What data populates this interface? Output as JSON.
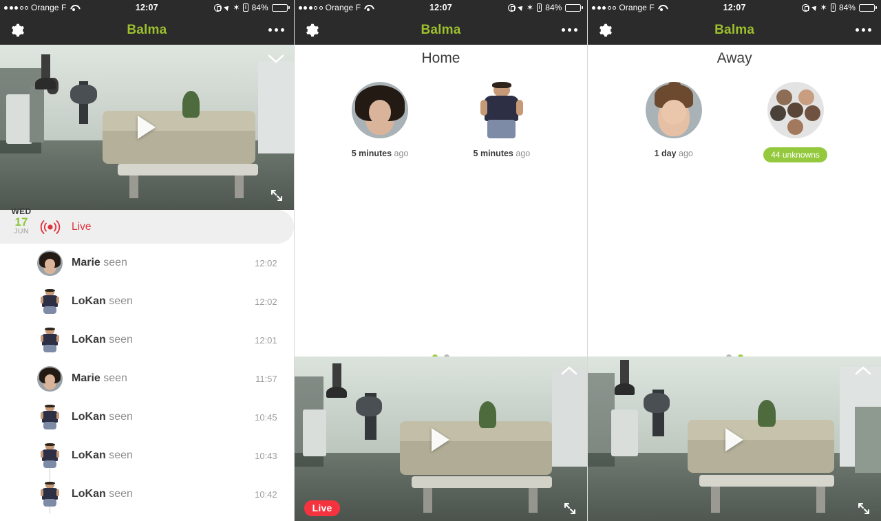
{
  "status_bar": {
    "signal_filled": 3,
    "signal_hollow": 2,
    "carrier": "Orange F",
    "wifi_icon": "wifi-icon",
    "time": "12:07",
    "lock_icon": "rotation-lock-icon",
    "location_icon": "location-arrow-icon",
    "bluetooth_icon": "bluetooth-icon",
    "bluetooth_glyph": "✶",
    "info_icon": "info-icon",
    "info_glyph": "i",
    "battery_percent": "84%",
    "battery_level": 84
  },
  "nav": {
    "gear_icon": "gear-icon",
    "title": "Balma",
    "more_icon": "ellipsis-icon",
    "title_color": "#9dc02e",
    "bar_color": "#2b2b2b"
  },
  "screen1": {
    "video": {
      "play_icon": "play-icon",
      "collapse_icon": "chevron-down-icon",
      "expand_icon": "expand-icon"
    },
    "timeline": {
      "date": {
        "dow": "WED",
        "day": "17",
        "month": "JUN"
      },
      "live": {
        "icon": "live-broadcast-icon",
        "label": "Live",
        "color": "#e0323f"
      },
      "items": [
        {
          "avatar": "marie-avatar",
          "name": "Marie",
          "action": "seen",
          "time": "12:02"
        },
        {
          "avatar": "lokan-avatar",
          "name": "LoKan",
          "action": "seen",
          "time": "12:02"
        },
        {
          "avatar": "lokan-avatar",
          "name": "LoKan",
          "action": "seen",
          "time": "12:01"
        },
        {
          "avatar": "marie-avatar",
          "name": "Marie",
          "action": "seen",
          "time": "11:57"
        },
        {
          "avatar": "lokan-avatar",
          "name": "LoKan",
          "action": "seen",
          "time": "10:45"
        },
        {
          "avatar": "lokan-avatar",
          "name": "LoKan",
          "action": "seen",
          "time": "10:43"
        },
        {
          "avatar": "lokan-avatar",
          "name": "LoKan",
          "action": "seen",
          "time": "10:42"
        }
      ]
    }
  },
  "screen2": {
    "people": {
      "title": "Home",
      "cards": [
        {
          "avatar": "marie-avatar",
          "time_strong": "5 minutes",
          "time_weak": "ago"
        },
        {
          "avatar": "lokan-avatar",
          "time_strong": "5 minutes",
          "time_weak": "ago"
        }
      ],
      "page_dots": {
        "count": 2,
        "active": 0
      }
    },
    "video": {
      "play_icon": "play-icon",
      "expand_up_icon": "chevron-up-icon",
      "expand_icon": "expand-icon",
      "live_badge": "Live",
      "live_badge_color": "#f5333f"
    }
  },
  "screen3": {
    "people": {
      "title": "Away",
      "cards": [
        {
          "avatar": "child-avatar",
          "time_strong": "1 day",
          "time_weak": "ago"
        },
        {
          "avatar": "unknowns-cluster-avatar",
          "badge": "44 unknowns",
          "badge_color": "#94c93d"
        }
      ],
      "page_dots": {
        "count": 2,
        "active": 1
      }
    },
    "video": {
      "play_icon": "play-icon",
      "expand_up_icon": "chevron-up-icon",
      "expand_icon": "expand-icon"
    }
  }
}
